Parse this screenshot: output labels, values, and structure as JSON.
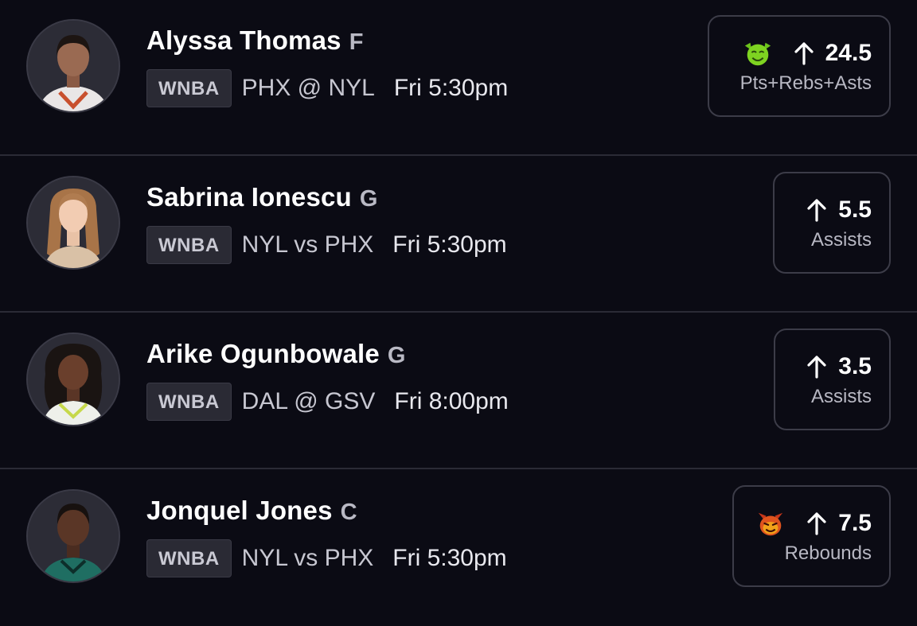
{
  "colors": {
    "background": "#0b0b14",
    "divider": "#2b2b36",
    "card_border": "#3c3c48",
    "badge_bg": "#2a2a34",
    "goblin_green": "#7ed321",
    "demon_red": "#e0541e"
  },
  "players": [
    {
      "name": "Alyssa Thomas",
      "position": "F",
      "league": "WNBA",
      "matchup": "PHX @ NYL",
      "time": "Fri 5:30pm",
      "direction": "up-arrow-icon",
      "line": "24.5",
      "stat": "Pts+Rebs+Asts",
      "badge_icon": "goblin-icon"
    },
    {
      "name": "Sabrina Ionescu",
      "position": "G",
      "league": "WNBA",
      "matchup": "NYL vs PHX",
      "time": "Fri 5:30pm",
      "direction": "up-arrow-icon",
      "line": "5.5",
      "stat": "Assists",
      "badge_icon": ""
    },
    {
      "name": "Arike Ogunbowale",
      "position": "G",
      "league": "WNBA",
      "matchup": "DAL @ GSV",
      "time": "Fri 8:00pm",
      "direction": "up-arrow-icon",
      "line": "3.5",
      "stat": "Assists",
      "badge_icon": ""
    },
    {
      "name": "Jonquel Jones",
      "position": "C",
      "league": "WNBA",
      "matchup": "NYL vs PHX",
      "time": "Fri 5:30pm",
      "direction": "up-arrow-icon",
      "line": "7.5",
      "stat": "Rebounds",
      "badge_icon": "demon-icon"
    }
  ]
}
